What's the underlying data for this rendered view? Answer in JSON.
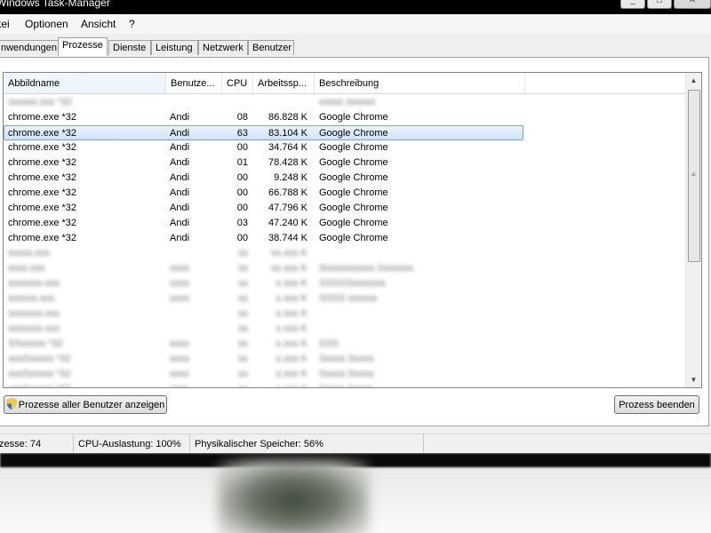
{
  "window": {
    "title": "Windows Task-Manager",
    "min": "_",
    "max": "□",
    "close": "✕"
  },
  "menu": [
    "tei",
    "Optionen",
    "Ansicht",
    "?"
  ],
  "tabs": [
    "nwendungen",
    "Prozesse",
    "Dienste",
    "Leistung",
    "Netzwerk",
    "Benutzer"
  ],
  "active_tab": "Prozesse",
  "columns": [
    "Abbildname",
    "Benutze...",
    "CPU",
    "Arbeitssp...",
    "Beschreibung"
  ],
  "sort_column": "Abbildname",
  "rows": [
    {
      "name": "",
      "user": "",
      "cpu": "",
      "mem": "",
      "desc": "",
      "blurred": true,
      "blur_text": [
        "ssssss.sss *32",
        "",
        "",
        "",
        "sssss ssssss"
      ]
    },
    {
      "name": "chrome.exe *32",
      "user": "Andi",
      "cpu": "08",
      "mem": "86.828 K",
      "desc": "Google Chrome"
    },
    {
      "name": "chrome.exe *32",
      "user": "Andi",
      "cpu": "63",
      "mem": "83.104 K",
      "desc": "Google Chrome",
      "selected": true
    },
    {
      "name": "chrome.exe *32",
      "user": "Andi",
      "cpu": "00",
      "mem": "34.764 K",
      "desc": "Google Chrome"
    },
    {
      "name": "chrome.exe *32",
      "user": "Andi",
      "cpu": "01",
      "mem": "78.428 K",
      "desc": "Google Chrome"
    },
    {
      "name": "chrome.exe *32",
      "user": "Andi",
      "cpu": "00",
      "mem": "9.248 K",
      "desc": "Google Chrome"
    },
    {
      "name": "chrome.exe *32",
      "user": "Andi",
      "cpu": "00",
      "mem": "66.788 K",
      "desc": "Google Chrome"
    },
    {
      "name": "chrome.exe *32",
      "user": "Andi",
      "cpu": "00",
      "mem": "47.796 K",
      "desc": "Google Chrome"
    },
    {
      "name": "chrome.exe *32",
      "user": "Andi",
      "cpu": "03",
      "mem": "47.240 K",
      "desc": "Google Chrome"
    },
    {
      "name": "chrome.exe *32",
      "user": "Andi",
      "cpu": "00",
      "mem": "38.744 K",
      "desc": "Google Chrome"
    },
    {
      "blurred": true,
      "blur_text": [
        "sssss.sss",
        "",
        "ss",
        "ss.sss K",
        ""
      ]
    },
    {
      "blurred": true,
      "blur_text": [
        "ssss.sss",
        "ssss",
        "ss",
        "ss.sss K",
        "Sssssssssss Sssssss"
      ]
    },
    {
      "blurred": true,
      "blur_text": [
        "sssssss.sss",
        "ssss",
        "ss",
        "s.sss K",
        "SSSSSsssssss"
      ]
    },
    {
      "blurred": true,
      "blur_text": [
        "ssssss.sss",
        "ssss",
        "ss",
        "s.sss K",
        "SSSS ssssss"
      ]
    },
    {
      "blurred": true,
      "blur_text": [
        "sssssss.sss",
        "",
        "ss",
        "s.sss K",
        ""
      ]
    },
    {
      "blurred": true,
      "blur_text": [
        "sssssss.sss",
        "",
        "ss",
        "s.sss K",
        ""
      ]
    },
    {
      "blurred": true,
      "blur_text": [
        "SSsssss *32",
        "ssss",
        "ss",
        "s.sss K",
        "SSS"
      ]
    },
    {
      "blurred": true,
      "blur_text": [
        "sssSsssss *32",
        "ssss",
        "ss",
        "s.sss K",
        "Sssss Sssss"
      ]
    },
    {
      "blurred": true,
      "blur_text": [
        "sssSsssss *32",
        "ssss",
        "ss",
        "s.sss K",
        "Sssss Sssss"
      ]
    },
    {
      "blurred": true,
      "blur_text": [
        "sssSsssss *32",
        "ssss",
        "ss",
        "s.sss K",
        "Sssss Sssss"
      ]
    }
  ],
  "buttons": {
    "all_users": "Prozesse aller Benutzer anzeigen",
    "end_process": "Prozess beenden"
  },
  "status": {
    "processes": "zesse: 74",
    "cpu": "CPU-Auslastung: 100%",
    "memory": "Physikalischer Speicher: 56%"
  },
  "scroll_grip": "≡",
  "scroll_up": "▲",
  "scroll_down": "▼",
  "sort_arrow": "^"
}
